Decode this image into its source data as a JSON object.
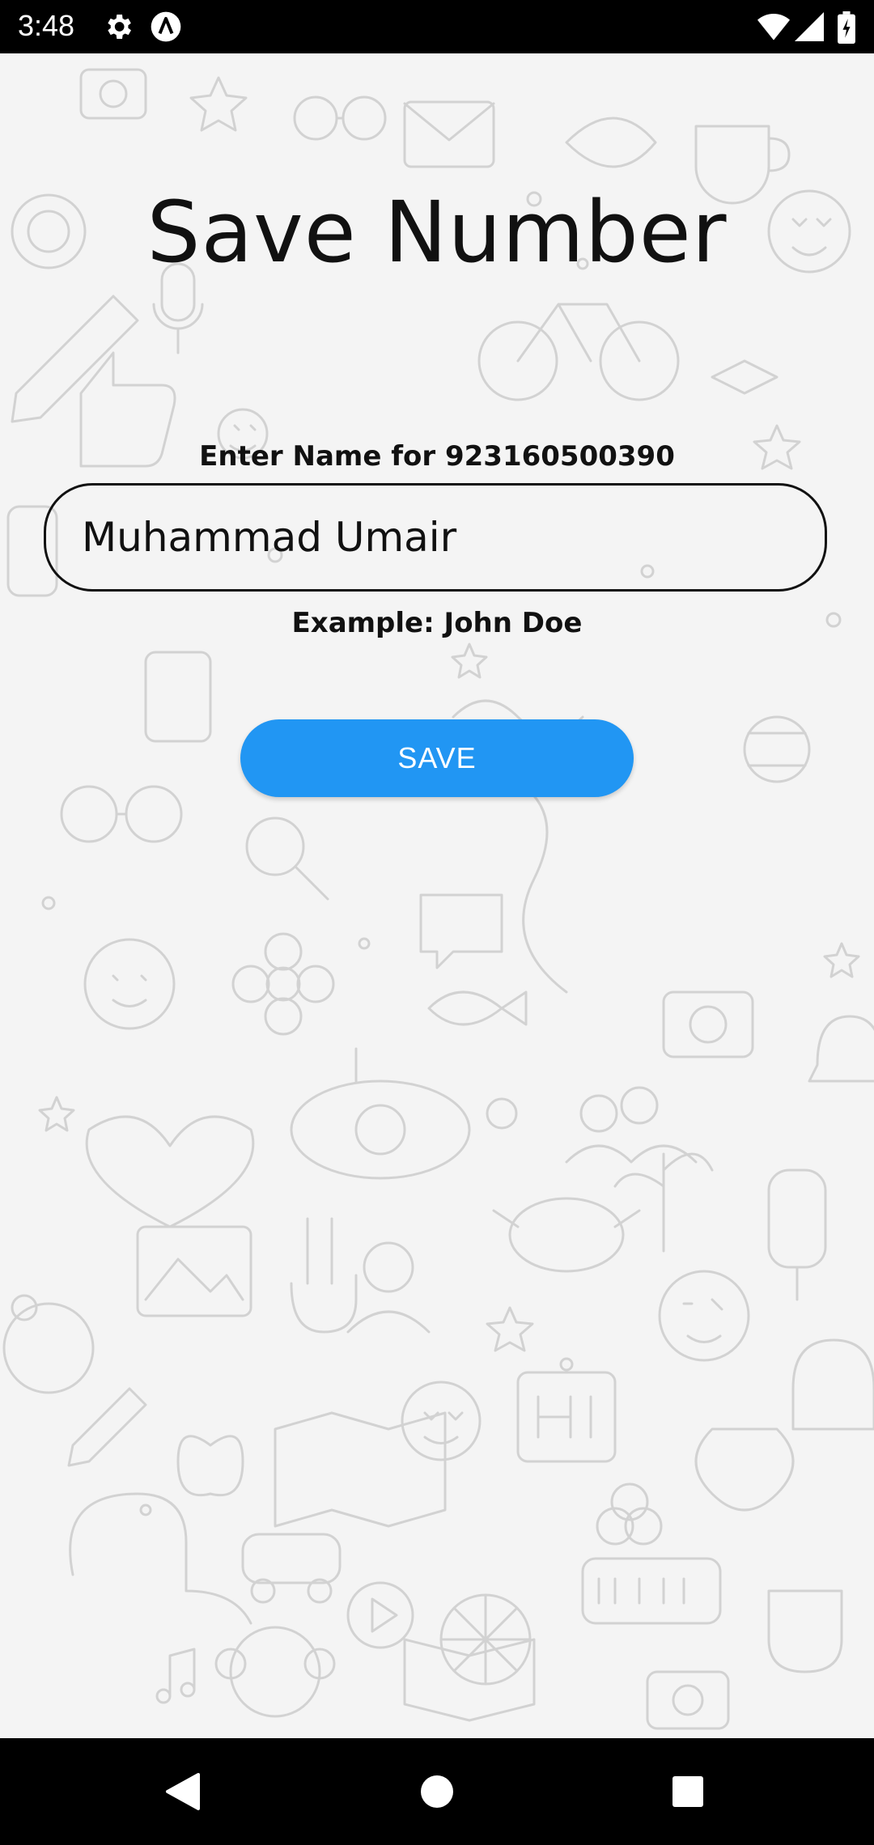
{
  "status_bar": {
    "time": "3:48",
    "left_icons": [
      "gear-icon",
      "accessibility-a-icon"
    ],
    "right_icons": [
      "wifi-icon",
      "cell-signal-icon",
      "battery-icon"
    ]
  },
  "screen": {
    "title": "Save Number",
    "label": "Enter Name for 923160500390",
    "name_value": "Muhammad Umair",
    "hint": "Example: John Doe",
    "save_label": "SAVE"
  },
  "nav_bar": {
    "buttons": [
      "back-icon",
      "home-icon",
      "recents-icon"
    ]
  },
  "colors": {
    "accent": "#2196f3",
    "background": "#f4f4f4",
    "doodle": "#d3d3d3"
  }
}
